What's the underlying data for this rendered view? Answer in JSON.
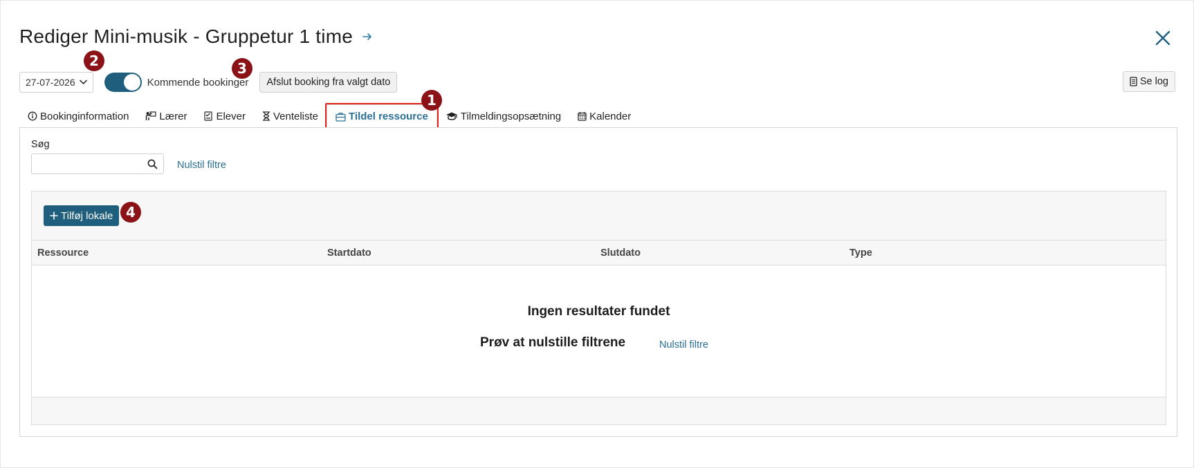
{
  "header": {
    "title": "Rediger Mini-musik - Gruppetur 1 time"
  },
  "toolbar": {
    "date_value": "27-07-2026",
    "toggle_label": "Kommende bookinger",
    "toggle_on": true,
    "end_booking_label": "Afslut booking fra valgt dato",
    "log_label": "Se log"
  },
  "tabs": [
    {
      "label": "Bookinginformation",
      "icon": "info-circle-icon",
      "active": false
    },
    {
      "label": "Lærer",
      "icon": "teacher-icon",
      "active": false
    },
    {
      "label": "Elever",
      "icon": "students-icon",
      "active": false
    },
    {
      "label": "Venteliste",
      "icon": "hourglass-icon",
      "active": false
    },
    {
      "label": "Tildel ressource",
      "icon": "briefcase-icon",
      "active": true
    },
    {
      "label": "Tilmeldingsopsætning",
      "icon": "graduation-cap-icon",
      "active": false
    },
    {
      "label": "Kalender",
      "icon": "calendar-icon",
      "active": false
    }
  ],
  "search": {
    "label": "Søg",
    "value": "",
    "placeholder": "",
    "reset_label": "Nulstil filtre"
  },
  "resources": {
    "add_label": "Tilføj lokale",
    "columns": [
      "Ressource",
      "Startdato",
      "Slutdato",
      "Type"
    ],
    "rows": [],
    "empty_title": "Ingen resultater fundet",
    "empty_hint": "Prøv at nulstille filtrene",
    "empty_reset_label": "Nulstil filtre"
  },
  "markers": [
    "1",
    "2",
    "3",
    "4"
  ],
  "colors": {
    "primary": "#1f5f7d",
    "link": "#2a6f96",
    "marker": "#8b1317",
    "highlight": "#e0231d"
  }
}
